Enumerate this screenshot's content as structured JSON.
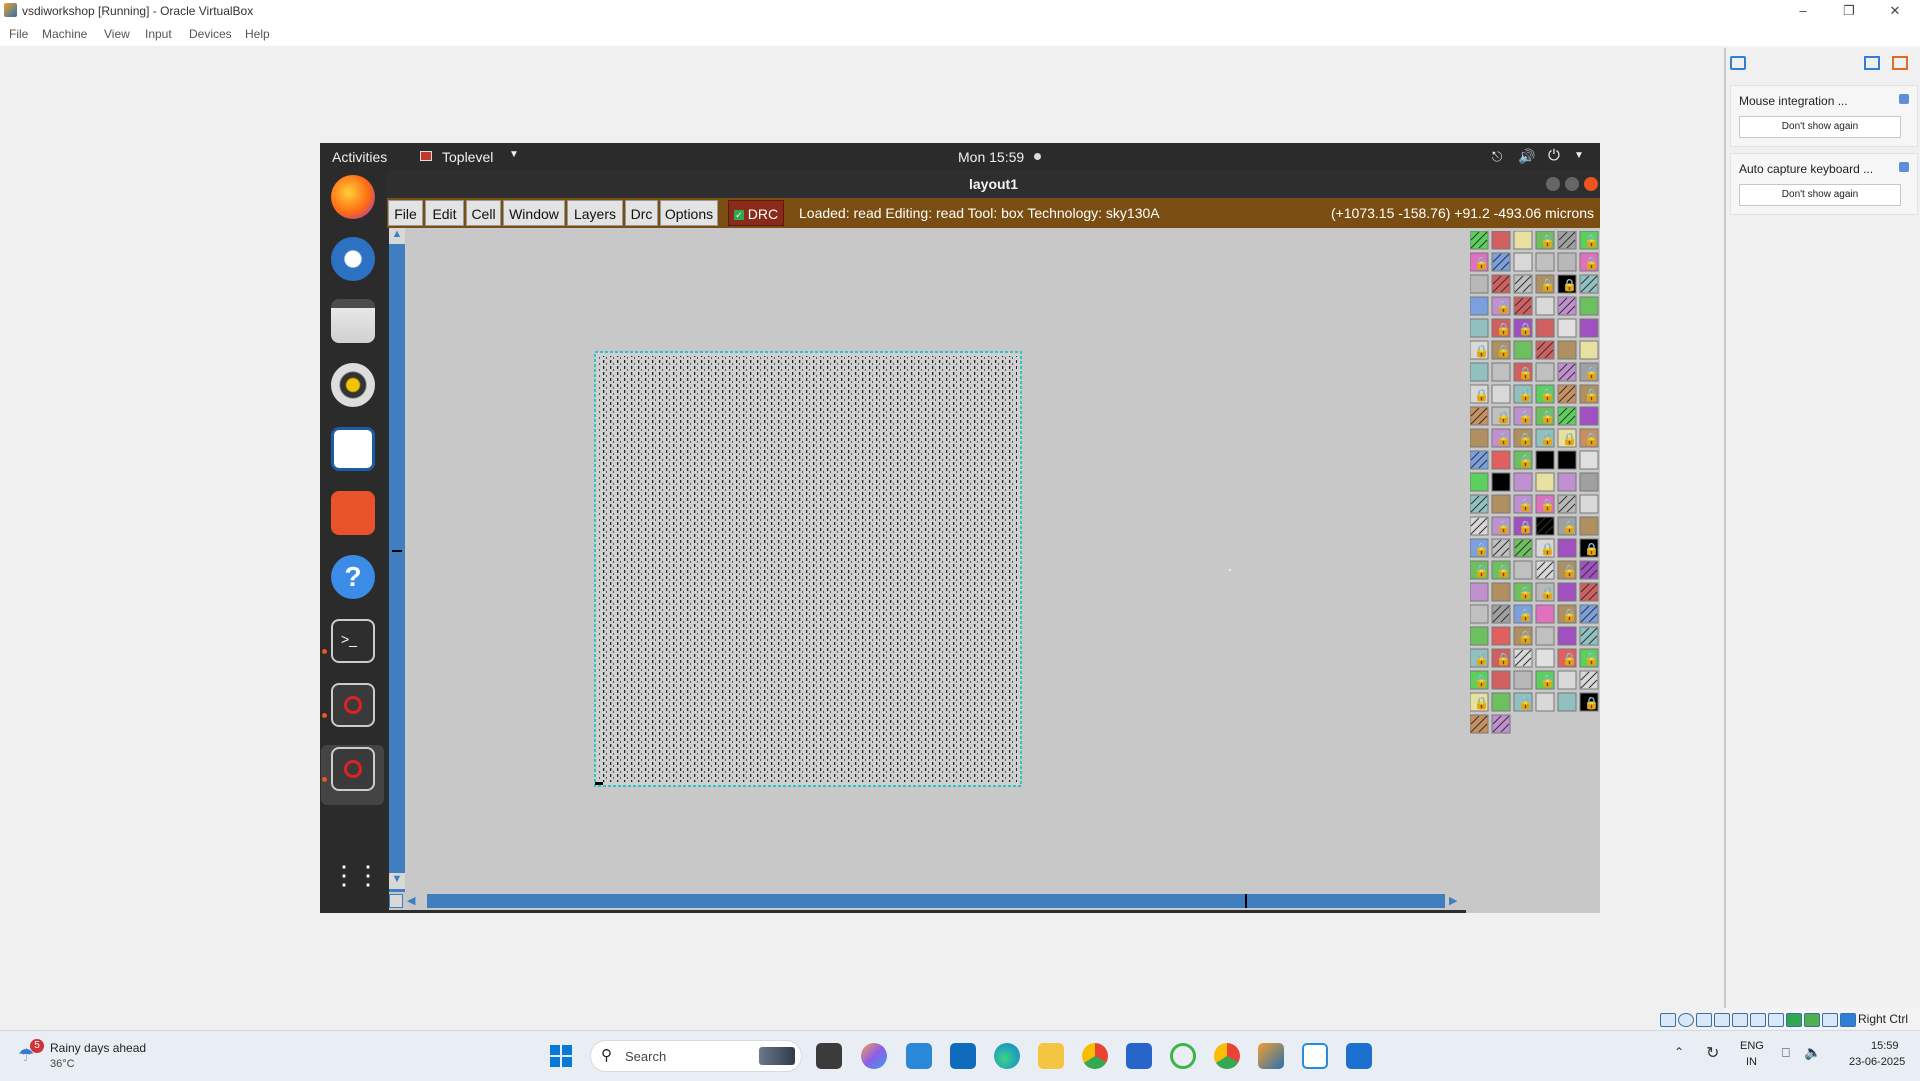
{
  "host": {
    "window_title": "vsdiworkshop [Running] - Oracle VirtualBox",
    "menu": [
      "File",
      "Machine",
      "View",
      "Input",
      "Devices",
      "Help"
    ],
    "status_right": "Right Ctrl"
  },
  "notifications": [
    {
      "title": "Mouse integration ...",
      "button": "Don't show again"
    },
    {
      "title": "Auto capture keyboard ...",
      "button": "Don't show again"
    }
  ],
  "guest": {
    "activities": "Activities",
    "app_menu": "Toplevel",
    "clock": "Mon 15:59",
    "dock_apps": [
      "firefox-icon",
      "thunderbird-icon",
      "files-icon",
      "rhythmbox-icon",
      "writer-icon",
      "software-icon",
      "help-icon",
      "terminal-icon",
      "magic-icon",
      "magic-icon",
      "show-apps-icon"
    ]
  },
  "magic": {
    "window_title": "layout1",
    "menu": [
      "File",
      "Edit",
      "Cell",
      "Window",
      "Layers",
      "Drc",
      "Options"
    ],
    "drc_label": "DRC",
    "status": "Loaded: read Editing: read Tool: box  Technology: sky130A",
    "coords": "(+1073.15 -158.76) +91.2 -493.06 microns"
  },
  "taskbar": {
    "weather_title": "Rainy days ahead",
    "weather_temp": "36°C",
    "weather_badge": "5",
    "search_placeholder": "Search",
    "lang_top": "ENG",
    "lang_bottom": "IN",
    "time": "15:59",
    "date": "23-06-2025"
  },
  "colors": {
    "magic_menu_bg": "#7a4e13",
    "scroll_blue": "#3f7fbf",
    "canvas_bg": "#c8c8c8",
    "ubuntu_accent": "#e95420"
  }
}
